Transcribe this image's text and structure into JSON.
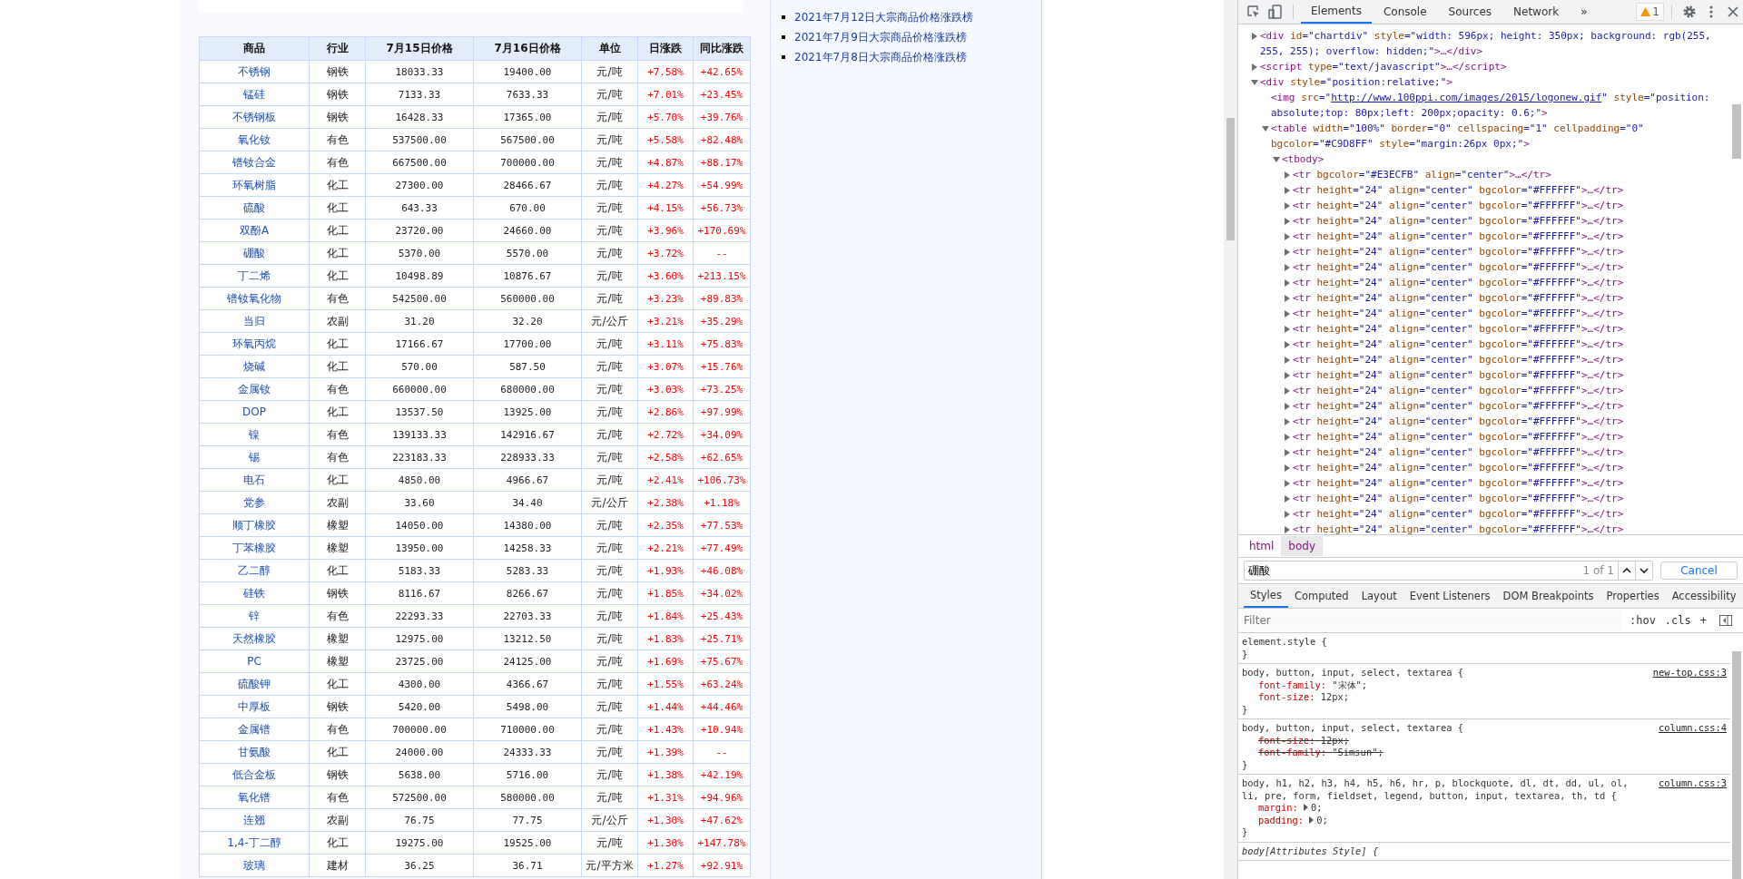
{
  "table": {
    "columns": [
      "商品",
      "行业",
      "7月15日价格",
      "7月16日价格",
      "单位",
      "日涨跌",
      "同比涨跌"
    ],
    "rows": [
      [
        "不锈钢",
        "钢铁",
        "18033.33",
        "19400.00",
        "元/吨",
        "+7.58%",
        "+42.65%"
      ],
      [
        "锰硅",
        "钢铁",
        "7133.33",
        "7633.33",
        "元/吨",
        "+7.01%",
        "+23.45%"
      ],
      [
        "不锈钢板",
        "钢铁",
        "16428.33",
        "17365.00",
        "元/吨",
        "+5.70%",
        "+39.76%"
      ],
      [
        "氧化钕",
        "有色",
        "537500.00",
        "567500.00",
        "元/吨",
        "+5.58%",
        "+82.48%"
      ],
      [
        "镨钕合金",
        "有色",
        "667500.00",
        "700000.00",
        "元/吨",
        "+4.87%",
        "+88.17%"
      ],
      [
        "环氧树脂",
        "化工",
        "27300.00",
        "28466.67",
        "元/吨",
        "+4.27%",
        "+54.99%"
      ],
      [
        "硫酸",
        "化工",
        "643.33",
        "670.00",
        "元/吨",
        "+4.15%",
        "+56.73%"
      ],
      [
        "双酚A",
        "化工",
        "23720.00",
        "24660.00",
        "元/吨",
        "+3.96%",
        "+170.69%"
      ],
      [
        "硼酸",
        "化工",
        "5370.00",
        "5570.00",
        "元/吨",
        "+3.72%",
        "--"
      ],
      [
        "丁二烯",
        "化工",
        "10498.89",
        "10876.67",
        "元/吨",
        "+3.60%",
        "+213.15%"
      ],
      [
        "镨钕氧化物",
        "有色",
        "542500.00",
        "560000.00",
        "元/吨",
        "+3.23%",
        "+89.83%"
      ],
      [
        "当归",
        "农副",
        "31.20",
        "32.20",
        "元/公斤",
        "+3.21%",
        "+35.29%"
      ],
      [
        "环氧丙烷",
        "化工",
        "17166.67",
        "17700.00",
        "元/吨",
        "+3.11%",
        "+75.83%"
      ],
      [
        "烧碱",
        "化工",
        "570.00",
        "587.50",
        "元/吨",
        "+3.07%",
        "+15.76%"
      ],
      [
        "金属钕",
        "有色",
        "660000.00",
        "680000.00",
        "元/吨",
        "+3.03%",
        "+73.25%"
      ],
      [
        "DOP",
        "化工",
        "13537.50",
        "13925.00",
        "元/吨",
        "+2.86%",
        "+97.99%"
      ],
      [
        "镍",
        "有色",
        "139133.33",
        "142916.67",
        "元/吨",
        "+2.72%",
        "+34.09%"
      ],
      [
        "锡",
        "有色",
        "223183.33",
        "228933.33",
        "元/吨",
        "+2.58%",
        "+62.65%"
      ],
      [
        "电石",
        "化工",
        "4850.00",
        "4966.67",
        "元/吨",
        "+2.41%",
        "+106.73%"
      ],
      [
        "党参",
        "农副",
        "33.60",
        "34.40",
        "元/公斤",
        "+2.38%",
        "+1.18%"
      ],
      [
        "顺丁橡胶",
        "橡塑",
        "14050.00",
        "14380.00",
        "元/吨",
        "+2.35%",
        "+77.53%"
      ],
      [
        "丁苯橡胶",
        "橡塑",
        "13950.00",
        "14258.33",
        "元/吨",
        "+2.21%",
        "+77.49%"
      ],
      [
        "乙二醇",
        "化工",
        "5183.33",
        "5283.33",
        "元/吨",
        "+1.93%",
        "+46.08%"
      ],
      [
        "硅铁",
        "钢铁",
        "8116.67",
        "8266.67",
        "元/吨",
        "+1.85%",
        "+34.02%"
      ],
      [
        "锌",
        "有色",
        "22293.33",
        "22703.33",
        "元/吨",
        "+1.84%",
        "+25.43%"
      ],
      [
        "天然橡胶",
        "橡塑",
        "12975.00",
        "13212.50",
        "元/吨",
        "+1.83%",
        "+25.71%"
      ],
      [
        "PC",
        "橡塑",
        "23725.00",
        "24125.00",
        "元/吨",
        "+1.69%",
        "+75.67%"
      ],
      [
        "硫酸钾",
        "化工",
        "4300.00",
        "4366.67",
        "元/吨",
        "+1.55%",
        "+63.24%"
      ],
      [
        "中厚板",
        "钢铁",
        "5420.00",
        "5498.00",
        "元/吨",
        "+1.44%",
        "+44.46%"
      ],
      [
        "金属镨",
        "有色",
        "700000.00",
        "710000.00",
        "元/吨",
        "+1.43%",
        "+10.94%"
      ],
      [
        "甘氨酸",
        "化工",
        "24000.00",
        "24333.33",
        "元/吨",
        "+1.39%",
        "--"
      ],
      [
        "低合金板",
        "钢铁",
        "5638.00",
        "5716.00",
        "元/吨",
        "+1.38%",
        "+42.19%"
      ],
      [
        "氧化镨",
        "有色",
        "572500.00",
        "580000.00",
        "元/吨",
        "+1.31%",
        "+94.96%"
      ],
      [
        "连翘",
        "农副",
        "76.75",
        "77.75",
        "元/公斤",
        "+1.30%",
        "+47.62%"
      ],
      [
        "1,4-丁二醇",
        "化工",
        "19275.00",
        "19525.00",
        "元/吨",
        "+1.30%",
        "+147.78%"
      ],
      [
        "玻璃",
        "建材",
        "36.25",
        "36.71",
        "元/平方米",
        "+1.27%",
        "+92.91%"
      ]
    ]
  },
  "related_links": [
    "2021年7月12日大宗商品价格涨跌榜",
    "2021年7月9日大宗商品价格涨跌榜",
    "2021年7月8日大宗商品价格涨跌榜"
  ],
  "devtools": {
    "tabs": [
      {
        "label": "Elements",
        "selected": true
      },
      {
        "label": "Console",
        "selected": false
      },
      {
        "label": "Sources",
        "selected": false
      },
      {
        "label": "Network",
        "selected": false
      }
    ],
    "more_tabs": "»",
    "warnings": "1",
    "dom": [
      {
        "expanded": false,
        "tag": "<div",
        "attrs": [
          {
            "name": "id",
            "value": "=\"chartdiv\""
          },
          {
            "name": "style",
            "value": "=\"width: 596px; height: 350px; background: rgb(255, 255, 255); overflow: hidden;\""
          }
        ],
        "tail": ">…</div>"
      },
      {
        "expanded": false,
        "tag": "<script",
        "attrs": [
          {
            "name": "type",
            "value": "=\"text/javascript\""
          }
        ],
        "tail": ">…</script>"
      },
      {
        "expanded": true,
        "tag": "<div",
        "attrs": [
          {
            "name": "style",
            "value": "=\"position:relative;\""
          }
        ],
        "tail": ">",
        "children": [
          {
            "tag": "<img",
            "attrs": [
              {
                "name": "src",
                "value": "=\"",
                "link": "http://www.100ppi.com/images/2015/logonew.gif",
                "after": "\""
              },
              {
                "name": "style",
                "value": "=\"position: absolute;top: 80px;left: 200px;opacity: 0.6;\""
              }
            ],
            "tail": ">"
          },
          {
            "expanded": true,
            "tag": "<table",
            "attrs": [
              {
                "name": "width",
                "value": "=\"100%\""
              },
              {
                "name": "border",
                "value": "=\"0\""
              },
              {
                "name": "cellspacing",
                "value": "=\"1\""
              },
              {
                "name": "cellpadding",
                "value": "=\"0\""
              },
              {
                "name": "bgcolor",
                "value": "=\"#C9D8FF\""
              },
              {
                "name": "style",
                "value": "=\"margin:26px 0px;\""
              }
            ],
            "tail": ">",
            "children": [
              {
                "expanded": true,
                "tag": "<tbody",
                "tail": ">",
                "children": [
                  {
                    "expanded": false,
                    "tag": "<tr",
                    "attrs": [
                      {
                        "name": "bgcolor",
                        "value": "=\"#E3ECFB\""
                      },
                      {
                        "name": "align",
                        "value": "=\"center\""
                      }
                    ],
                    "tail": ">…</tr>"
                  },
                  {
                    "expanded": false,
                    "tag": "<tr",
                    "attrs": [
                      {
                        "name": "height",
                        "value": "=\"24\""
                      },
                      {
                        "name": "align",
                        "value": "=\"center\""
                      },
                      {
                        "name": "bgcolor",
                        "value": "=\"#FFFFFF\""
                      }
                    ],
                    "tail": ">…</tr>"
                  },
                  {
                    "expanded": false,
                    "tag": "<tr",
                    "attrs": [
                      {
                        "name": "height",
                        "value": "=\"24\""
                      },
                      {
                        "name": "align",
                        "value": "=\"center\""
                      },
                      {
                        "name": "bgcolor",
                        "value": "=\"#FFFFFF\""
                      }
                    ],
                    "tail": ">…</tr>"
                  },
                  {
                    "expanded": false,
                    "tag": "<tr",
                    "attrs": [
                      {
                        "name": "height",
                        "value": "=\"24\""
                      },
                      {
                        "name": "align",
                        "value": "=\"center\""
                      },
                      {
                        "name": "bgcolor",
                        "value": "=\"#FFFFFF\""
                      }
                    ],
                    "tail": ">…</tr>"
                  },
                  {
                    "expanded": false,
                    "tag": "<tr",
                    "attrs": [
                      {
                        "name": "height",
                        "value": "=\"24\""
                      },
                      {
                        "name": "align",
                        "value": "=\"center\""
                      },
                      {
                        "name": "bgcolor",
                        "value": "=\"#FFFFFF\""
                      }
                    ],
                    "tail": ">…</tr>"
                  },
                  {
                    "expanded": false,
                    "tag": "<tr",
                    "attrs": [
                      {
                        "name": "height",
                        "value": "=\"24\""
                      },
                      {
                        "name": "align",
                        "value": "=\"center\""
                      },
                      {
                        "name": "bgcolor",
                        "value": "=\"#FFFFFF\""
                      }
                    ],
                    "tail": ">…</tr>"
                  },
                  {
                    "expanded": false,
                    "tag": "<tr",
                    "attrs": [
                      {
                        "name": "height",
                        "value": "=\"24\""
                      },
                      {
                        "name": "align",
                        "value": "=\"center\""
                      },
                      {
                        "name": "bgcolor",
                        "value": "=\"#FFFFFF\""
                      }
                    ],
                    "tail": ">…</tr>"
                  },
                  {
                    "expanded": false,
                    "tag": "<tr",
                    "attrs": [
                      {
                        "name": "height",
                        "value": "=\"24\""
                      },
                      {
                        "name": "align",
                        "value": "=\"center\""
                      },
                      {
                        "name": "bgcolor",
                        "value": "=\"#FFFFFF\""
                      }
                    ],
                    "tail": ">…</tr>"
                  },
                  {
                    "expanded": false,
                    "tag": "<tr",
                    "attrs": [
                      {
                        "name": "height",
                        "value": "=\"24\""
                      },
                      {
                        "name": "align",
                        "value": "=\"center\""
                      },
                      {
                        "name": "bgcolor",
                        "value": "=\"#FFFFFF\""
                      }
                    ],
                    "tail": ">…</tr>"
                  },
                  {
                    "expanded": false,
                    "tag": "<tr",
                    "attrs": [
                      {
                        "name": "height",
                        "value": "=\"24\""
                      },
                      {
                        "name": "align",
                        "value": "=\"center\""
                      },
                      {
                        "name": "bgcolor",
                        "value": "=\"#FFFFFF\""
                      }
                    ],
                    "tail": ">…</tr>"
                  },
                  {
                    "expanded": false,
                    "tag": "<tr",
                    "attrs": [
                      {
                        "name": "height",
                        "value": "=\"24\""
                      },
                      {
                        "name": "align",
                        "value": "=\"center\""
                      },
                      {
                        "name": "bgcolor",
                        "value": "=\"#FFFFFF\""
                      }
                    ],
                    "tail": ">…</tr>"
                  },
                  {
                    "expanded": false,
                    "tag": "<tr",
                    "attrs": [
                      {
                        "name": "height",
                        "value": "=\"24\""
                      },
                      {
                        "name": "align",
                        "value": "=\"center\""
                      },
                      {
                        "name": "bgcolor",
                        "value": "=\"#FFFFFF\""
                      }
                    ],
                    "tail": ">…</tr>"
                  },
                  {
                    "expanded": false,
                    "tag": "<tr",
                    "attrs": [
                      {
                        "name": "height",
                        "value": "=\"24\""
                      },
                      {
                        "name": "align",
                        "value": "=\"center\""
                      },
                      {
                        "name": "bgcolor",
                        "value": "=\"#FFFFFF\""
                      }
                    ],
                    "tail": ">…</tr>"
                  },
                  {
                    "expanded": false,
                    "tag": "<tr",
                    "attrs": [
                      {
                        "name": "height",
                        "value": "=\"24\""
                      },
                      {
                        "name": "align",
                        "value": "=\"center\""
                      },
                      {
                        "name": "bgcolor",
                        "value": "=\"#FFFFFF\""
                      }
                    ],
                    "tail": ">…</tr>"
                  },
                  {
                    "expanded": false,
                    "tag": "<tr",
                    "attrs": [
                      {
                        "name": "height",
                        "value": "=\"24\""
                      },
                      {
                        "name": "align",
                        "value": "=\"center\""
                      },
                      {
                        "name": "bgcolor",
                        "value": "=\"#FFFFFF\""
                      }
                    ],
                    "tail": ">…</tr>"
                  },
                  {
                    "expanded": false,
                    "tag": "<tr",
                    "attrs": [
                      {
                        "name": "height",
                        "value": "=\"24\""
                      },
                      {
                        "name": "align",
                        "value": "=\"center\""
                      },
                      {
                        "name": "bgcolor",
                        "value": "=\"#FFFFFF\""
                      }
                    ],
                    "tail": ">…</tr>"
                  },
                  {
                    "expanded": false,
                    "tag": "<tr",
                    "attrs": [
                      {
                        "name": "height",
                        "value": "=\"24\""
                      },
                      {
                        "name": "align",
                        "value": "=\"center\""
                      },
                      {
                        "name": "bgcolor",
                        "value": "=\"#FFFFFF\""
                      }
                    ],
                    "tail": ">…</tr>"
                  },
                  {
                    "expanded": false,
                    "tag": "<tr",
                    "attrs": [
                      {
                        "name": "height",
                        "value": "=\"24\""
                      },
                      {
                        "name": "align",
                        "value": "=\"center\""
                      },
                      {
                        "name": "bgcolor",
                        "value": "=\"#FFFFFF\""
                      }
                    ],
                    "tail": ">…</tr>"
                  },
                  {
                    "expanded": false,
                    "tag": "<tr",
                    "attrs": [
                      {
                        "name": "height",
                        "value": "=\"24\""
                      },
                      {
                        "name": "align",
                        "value": "=\"center\""
                      },
                      {
                        "name": "bgcolor",
                        "value": "=\"#FFFFFF\""
                      }
                    ],
                    "tail": ">…</tr>"
                  },
                  {
                    "expanded": false,
                    "tag": "<tr",
                    "attrs": [
                      {
                        "name": "height",
                        "value": "=\"24\""
                      },
                      {
                        "name": "align",
                        "value": "=\"center\""
                      },
                      {
                        "name": "bgcolor",
                        "value": "=\"#FFFFFF\""
                      }
                    ],
                    "tail": ">…</tr>"
                  },
                  {
                    "expanded": false,
                    "tag": "<tr",
                    "attrs": [
                      {
                        "name": "height",
                        "value": "=\"24\""
                      },
                      {
                        "name": "align",
                        "value": "=\"center\""
                      },
                      {
                        "name": "bgcolor",
                        "value": "=\"#FFFFFF\""
                      }
                    ],
                    "tail": ">…</tr>"
                  },
                  {
                    "expanded": false,
                    "tag": "<tr",
                    "attrs": [
                      {
                        "name": "height",
                        "value": "=\"24\""
                      },
                      {
                        "name": "align",
                        "value": "=\"center\""
                      },
                      {
                        "name": "bgcolor",
                        "value": "=\"#FFFFFF\""
                      }
                    ],
                    "tail": ">…</tr>"
                  },
                  {
                    "expanded": false,
                    "tag": "<tr",
                    "attrs": [
                      {
                        "name": "height",
                        "value": "=\"24\""
                      },
                      {
                        "name": "align",
                        "value": "=\"center\""
                      },
                      {
                        "name": "bgcolor",
                        "value": "=\"#FFFFFF\""
                      }
                    ],
                    "tail": ">…</tr>"
                  },
                  {
                    "expanded": false,
                    "tag": "<tr",
                    "attrs": [
                      {
                        "name": "height",
                        "value": "=\"24\""
                      },
                      {
                        "name": "align",
                        "value": "=\"center\""
                      },
                      {
                        "name": "bgcolor",
                        "value": "=\"#FFFFFF\""
                      }
                    ],
                    "tail": ">…</tr>"
                  }
                ]
              }
            ]
          }
        ]
      }
    ],
    "breadcrumbs": [
      {
        "label": "html",
        "selected": false
      },
      {
        "label": "body",
        "selected": true
      }
    ],
    "search": {
      "value": "硼酸",
      "count": "1 of 1",
      "cancel": "Cancel"
    },
    "pane_tabs": [
      {
        "label": "Styles",
        "selected": true
      },
      {
        "label": "Computed",
        "selected": false
      },
      {
        "label": "Layout",
        "selected": false
      },
      {
        "label": "Event Listeners",
        "selected": false
      },
      {
        "label": "DOM Breakpoints",
        "selected": false
      },
      {
        "label": "Properties",
        "selected": false
      },
      {
        "label": "Accessibility",
        "selected": false
      }
    ],
    "filter": {
      "placeholder": "Filter",
      "hov": ":hov",
      "cls": ".cls",
      "add": "+"
    },
    "rules": [
      {
        "kind": "plain",
        "selector": "element.style {",
        "close": "}"
      },
      {
        "kind": "plain",
        "selector": "body, button, input, select, textarea {",
        "source": "new-top.css:3",
        "properties": [
          {
            "name": "font-family:",
            "value": "\"宋体\";",
            "struck": false
          },
          {
            "name": "font-size:",
            "value": "12px;",
            "struck": false
          }
        ],
        "close": "}"
      },
      {
        "kind": "plain",
        "selector": "body, button, input, select, textarea {",
        "source": "column.css:4",
        "properties": [
          {
            "name": "font-size:",
            "value": "12px;",
            "struck": true
          },
          {
            "name": "font-family:",
            "value": "\"Simsun\";",
            "struck": true
          }
        ],
        "close": "}"
      },
      {
        "kind": "plain",
        "selector": "body, h1, h2, h3, h4, h5, h6, hr, p, blockquote, dl, dt, dd, ul, ol, li, pre, form, fieldset, legend, button, input, textarea, th, td {",
        "source": "column.css:3",
        "properties": [
          {
            "name": "margin:",
            "value": "0;",
            "struck": false,
            "expandable": true
          },
          {
            "name": "padding:",
            "value": "0;",
            "struck": false,
            "expandable": true
          }
        ],
        "close": "}"
      },
      {
        "kind": "attributes",
        "selector": "body[Attributes Style] {"
      }
    ]
  }
}
